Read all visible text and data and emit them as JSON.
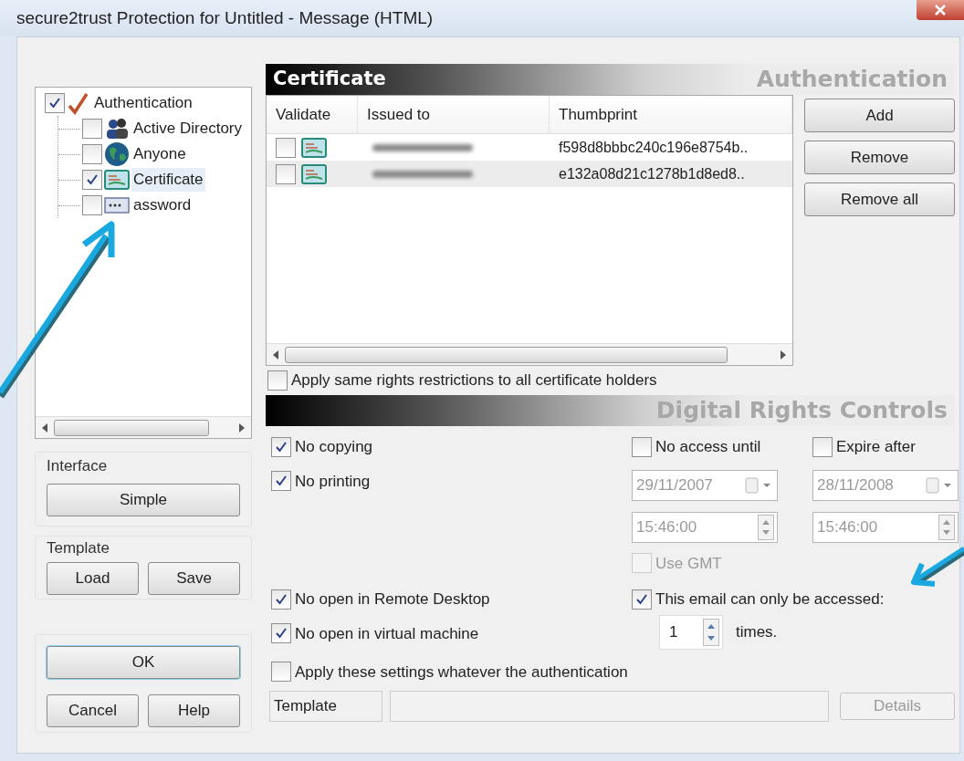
{
  "window": {
    "title": "secure2trust Protection for Untitled - Message (HTML)"
  },
  "tree": {
    "items": [
      {
        "label": "Authentication",
        "kind": "root",
        "checked": true,
        "selected": false,
        "children": [
          {
            "label": "Active Directory",
            "kind": "directory",
            "checked": false,
            "selected": false
          },
          {
            "label": "Anyone",
            "kind": "anyone",
            "checked": false,
            "selected": false
          },
          {
            "label": "Certificate",
            "kind": "certificate",
            "checked": true,
            "selected": true
          },
          {
            "label": "assword",
            "kind": "password",
            "checked": false,
            "selected": false
          }
        ]
      }
    ]
  },
  "interface_group": {
    "title": "Interface",
    "buttons": [
      "Simple"
    ]
  },
  "template_group": {
    "title": "Template",
    "buttons": [
      "Load",
      "Save"
    ]
  },
  "dialog_buttons": [
    {
      "label": "OK",
      "focused": true
    },
    {
      "label": "Cancel",
      "focused": false
    },
    {
      "label": "Help",
      "focused": false
    }
  ],
  "certificate_section": {
    "title": "Certificate",
    "section_label": "Authentication",
    "columns": [
      "Validate",
      "Issued to",
      "Thumbprint"
    ],
    "rows": [
      {
        "validate": false,
        "selected": false,
        "thumbprint": "f598d8bbbc240c196e8754b.."
      },
      {
        "validate": false,
        "selected": true,
        "thumbprint": "e132a08d21c1278b1d8ed8.."
      }
    ],
    "buttons": [
      "Add",
      "Remove",
      "Remove all"
    ],
    "apply_same": {
      "label": "Apply same rights restrictions to all certificate holders",
      "checked": false
    }
  },
  "rights_section": {
    "section_label": "Digital Rights Controls",
    "restrictions": [
      {
        "label": "No copying",
        "checked": true
      },
      {
        "label": "No printing",
        "checked": true
      }
    ],
    "no_access_until": {
      "label": "No access until",
      "checked": false,
      "date": "29/11/2007",
      "time": "15:46:00"
    },
    "expire_after": {
      "label": "Expire after",
      "checked": false,
      "date": "28/11/2008",
      "time": "15:46:00"
    },
    "use_gmt": {
      "label": "Use GMT",
      "checked": false,
      "disabled": true
    },
    "vm_restrictions": [
      {
        "label": "No open in Remote Desktop",
        "checked": true
      },
      {
        "label": "No open in virtual machine",
        "checked": true
      }
    ],
    "access_limit": {
      "label": "This email can only be accessed:",
      "checked": true,
      "count": "1",
      "unit": "times."
    },
    "apply_settings": {
      "label": "Apply these settings whatever the authentication",
      "checked": false
    },
    "template": {
      "label": "Template"
    },
    "details_button": {
      "label": "Details",
      "disabled": true
    }
  }
}
